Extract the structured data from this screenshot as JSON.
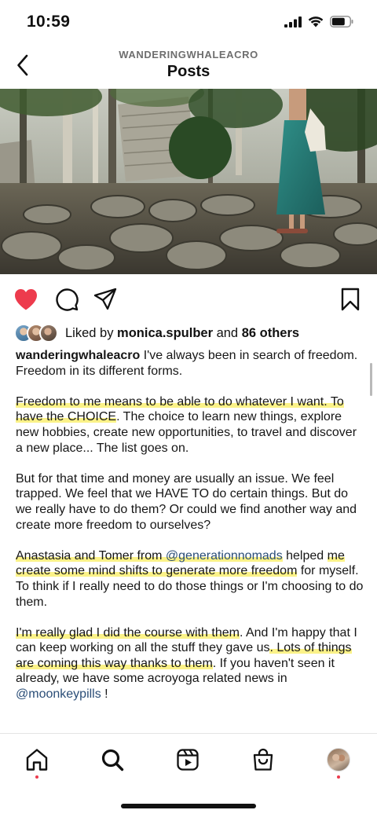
{
  "status": {
    "time": "10:59"
  },
  "header": {
    "account": "WANDERINGWHALEACRO",
    "title": "Posts"
  },
  "post": {
    "liked": true,
    "likes": {
      "prefix": "Liked by ",
      "user": "monica.spulber",
      "middle": " and ",
      "others": "86 others"
    },
    "caption": {
      "username": "wanderingwhaleacro",
      "p1": " I've always been in search of freedom. Freedom in its different forms.",
      "p2_hl": "Freedom to me means to be able to do whatever I want. To have the CHOICE",
      "p2_rest": ". The choice to learn new things, explore new hobbies, create new opportunities, to travel and discover a new place... The list goes on.",
      "p3": "But for that time and money are usually an issue. We feel trapped. We feel that we HAVE TO do certain things. But do we really have to do them? Or could we find another way and create more freedom to ourselves?",
      "p4_hl1": "Anastasia and Tomer from ",
      "p4_mention": "@generationnomads",
      "p4_mid": " helped ",
      "p4_hl2": "me create some mind shifts to generate more freedom",
      "p4_rest": " for myself. To think if I really need to do those things or I'm choosing to do them.",
      "p5_hl1": "I'm really glad I did the course with them",
      "p5_mid": ". And I'm happy that I can keep working on all the stuff they gave us",
      "p5_hl2": ". Lots of things are coming this way thanks to them",
      "p5_rest": ". If you haven't seen it already, we have some acroyoga related news in ",
      "p5_mention": "@moonkeypills",
      "p5_end": " !"
    }
  },
  "tabbar": {
    "items": [
      "home-icon",
      "search-icon",
      "reels-icon",
      "shop-icon",
      "profile-avatar"
    ]
  },
  "colors": {
    "like": "#ed3b4d",
    "mention": "#2a4d77",
    "highlight": "#faf073"
  }
}
